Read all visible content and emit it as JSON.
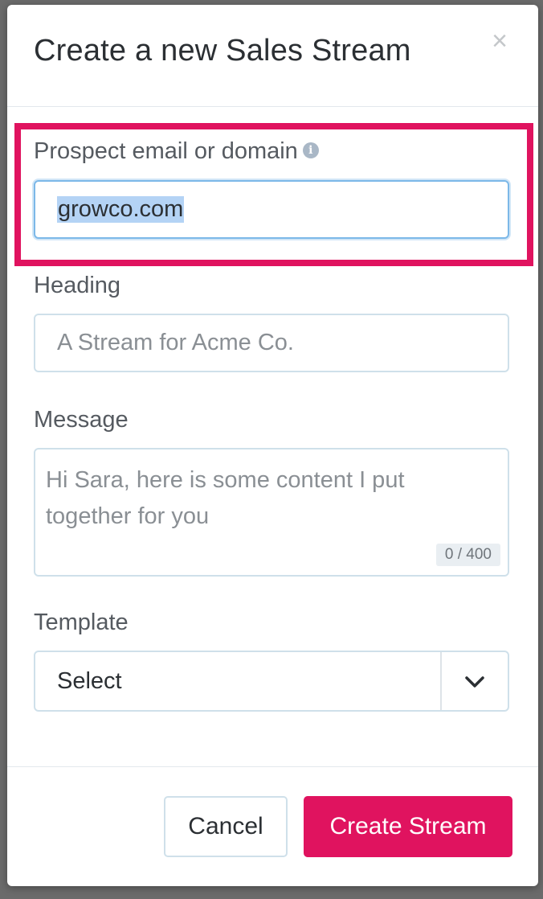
{
  "modal": {
    "title": "Create a new Sales Stream",
    "close_label": "×"
  },
  "form": {
    "prospect": {
      "label": "Prospect email or domain",
      "value": "growco.com",
      "info_icon": "i"
    },
    "heading": {
      "label": "Heading",
      "placeholder": "A Stream for Acme Co."
    },
    "message": {
      "label": "Message",
      "placeholder": "Hi Sara, here is some content I put together for you",
      "char_count": "0 / 400"
    },
    "template": {
      "label": "Template",
      "selected": "Select"
    }
  },
  "footer": {
    "cancel_label": "Cancel",
    "submit_label": "Create Stream"
  },
  "colors": {
    "accent": "#e0135f",
    "highlight": "#e0135f",
    "input_border": "#cfe0ea",
    "focus_border": "#7cb8e8",
    "selection": "#b4d3f5"
  }
}
